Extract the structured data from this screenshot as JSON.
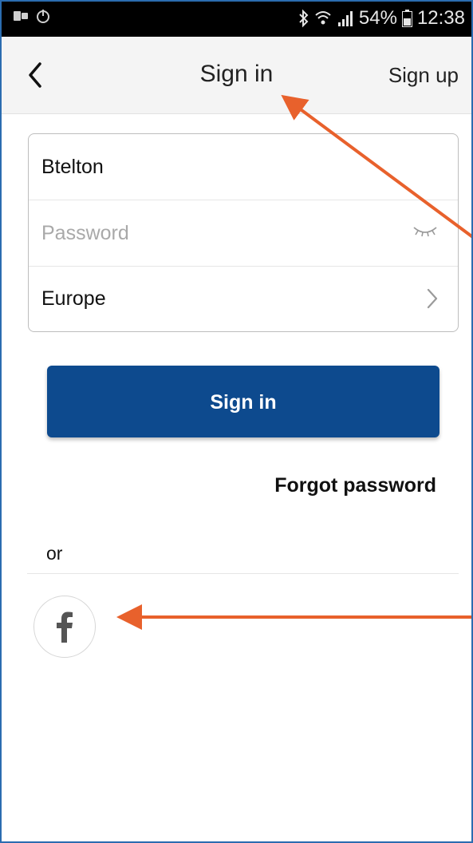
{
  "status_bar": {
    "battery": "54%",
    "time": "12:38"
  },
  "nav": {
    "title": "Sign in",
    "signup_label": "Sign up",
    "back_icon": "chevron-left-icon"
  },
  "form": {
    "username_value": "Btelton",
    "password_placeholder": "Password",
    "region_value": "Europe"
  },
  "actions": {
    "signin_label": "Sign in",
    "forgot_label": "Forgot password"
  },
  "social": {
    "or_label": "or",
    "facebook_icon": "facebook-icon"
  },
  "colors": {
    "primary": "#0d4a8e",
    "annotation_arrow": "#e8612c",
    "frame_border": "#2b6cb0"
  }
}
